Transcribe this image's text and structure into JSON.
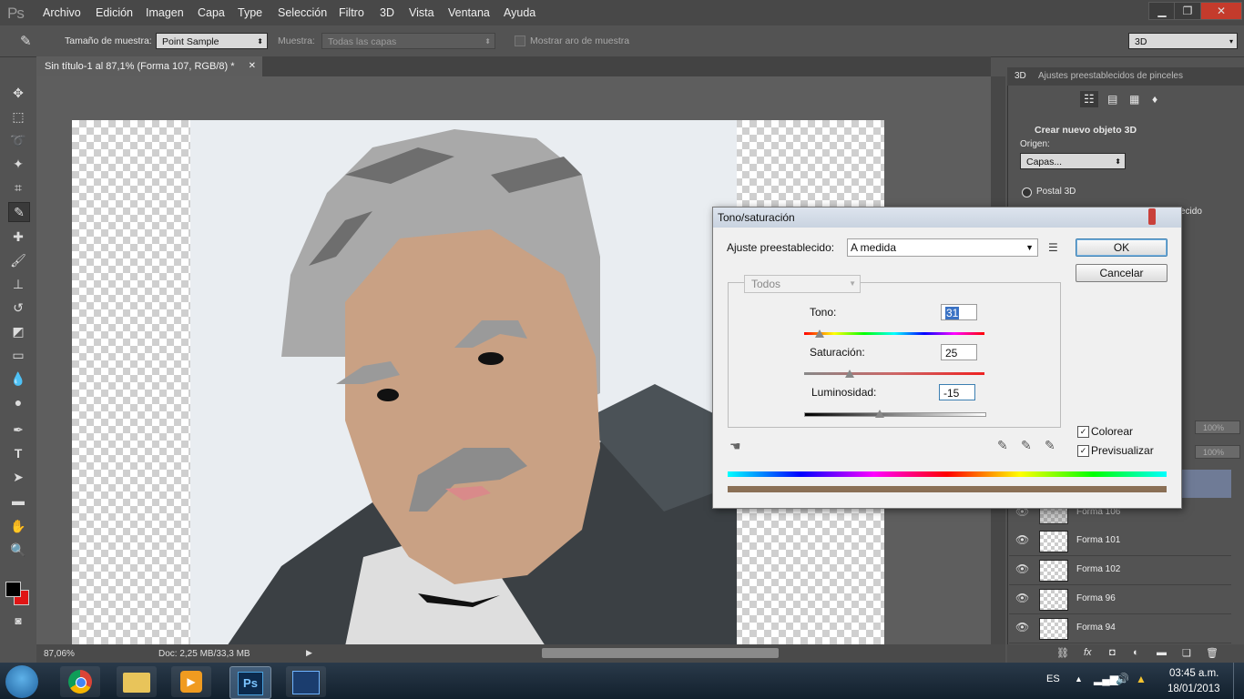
{
  "app": {
    "logo": "Ps"
  },
  "menu": [
    "Archivo",
    "Edición",
    "Imagen",
    "Capa",
    "Type",
    "Selección",
    "Filtro",
    "3D",
    "Vista",
    "Ventana",
    "Ayuda"
  ],
  "window_controls": {
    "minimize": "▁",
    "restore": "❐",
    "close": "✕"
  },
  "options": {
    "sample_size_label": "Tamaño de muestra:",
    "sample_size_value": "Point Sample",
    "sample_label": "Muestra:",
    "sample_value": "Todas las capas",
    "show_ring_label": "Mostrar aro de muestra",
    "workspace_value": "3D"
  },
  "document": {
    "tab_title": "Sin título-1 al 87,1% (Forma 107, RGB/8) *",
    "zoom": "87,06%",
    "doc_info": "Doc: 2,25 MB/33,3 MB"
  },
  "panel3d": {
    "tab_3d": "3D",
    "tab_brushes": "Ajustes preestablecidos de pinceles",
    "section_title": "Crear nuevo objeto 3D",
    "origin_label": "Origen:",
    "origin_value": "Capas...",
    "postal_label": "Postal 3D",
    "cut_text": "ecido"
  },
  "layers": [
    {
      "name": "Forma 106"
    },
    {
      "name": "Forma 101"
    },
    {
      "name": "Forma 102"
    },
    {
      "name": "Forma 96"
    },
    {
      "name": "Forma 94"
    }
  ],
  "layers_opacity": [
    "100%",
    "100%"
  ],
  "dialog": {
    "title": "Tono/saturación",
    "preset_label": "Ajuste preestablecido:",
    "preset_value": "A medida",
    "ok": "OK",
    "cancel": "Cancelar",
    "channel": "Todos",
    "hue_label": "Tono:",
    "hue_value": "31",
    "saturation_label": "Saturación:",
    "saturation_value": "25",
    "lightness_label": "Luminosidad:",
    "lightness_value": "-15",
    "colorize_label": "Colorear",
    "preview_label": "Previsualizar",
    "colorize_checked": "✓",
    "preview_checked": "✓"
  },
  "taskbar": {
    "language": "ES",
    "time": "03:45 a.m.",
    "date": "18/01/2013"
  },
  "colors": {
    "foreground": "#000000",
    "background": "#e01515",
    "colorize_swatch": "#8a6f55"
  }
}
